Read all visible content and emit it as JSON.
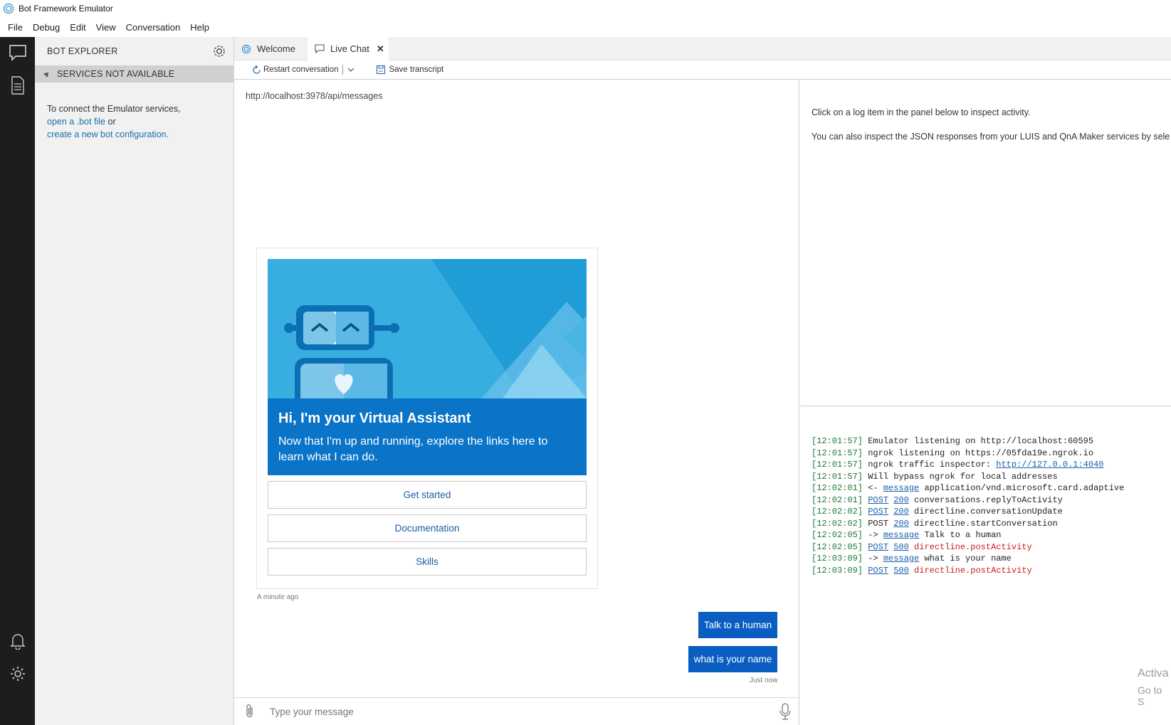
{
  "window": {
    "title": "Bot Framework Emulator"
  },
  "menu": {
    "items": [
      "File",
      "Debug",
      "Edit",
      "View",
      "Conversation",
      "Help"
    ]
  },
  "explorer": {
    "title": "BOT EXPLORER",
    "section": "SERVICES NOT AVAILABLE",
    "body_text": "To connect the Emulator services,",
    "link_open": "open a .bot file",
    "or_text": "or",
    "link_create": "create a new bot configuration."
  },
  "tabs": [
    {
      "label": "Welcome"
    },
    {
      "label": "Live Chat",
      "close": "✕"
    }
  ],
  "toolbar": {
    "restart_label": "Restart conversation",
    "save_label": "Save transcript"
  },
  "chat": {
    "endpoint": "http://localhost:3978/api/messages",
    "card": {
      "title_prefix": "Hi, I'm ",
      "title_bold": "your",
      "title_suffix": " Virtual Assistant",
      "subtitle": "Now that I'm up and running, explore the links here to learn what I can do.",
      "buttons": [
        "Get started",
        "Documentation",
        "Skills"
      ]
    },
    "card_timestamp": "A minute ago",
    "user_messages": [
      "Talk to a human",
      "what is your name"
    ],
    "last_timestamp": "Just now",
    "input_placeholder": "Type your message"
  },
  "inspector": {
    "line1": "Click on a log item in the panel below to inspect activity.",
    "line2": "You can also inspect the JSON responses from your LUIS and QnA Maker services by sele"
  },
  "log": [
    {
      "ts": "[12:01:57]",
      "parts": [
        {
          "t": "txt",
          "v": "Emulator listening on http://localhost:60595"
        }
      ]
    },
    {
      "ts": "[12:01:57]",
      "parts": [
        {
          "t": "txt",
          "v": "ngrok listening on https://05fda19e.ngrok.io"
        }
      ]
    },
    {
      "ts": "[12:01:57]",
      "parts": [
        {
          "t": "txt",
          "v": "ngrok traffic inspector: "
        },
        {
          "t": "lk",
          "v": "http://127.0.0.1:4040"
        }
      ]
    },
    {
      "ts": "[12:01:57]",
      "parts": [
        {
          "t": "txt",
          "v": "Will bypass ngrok for local addresses"
        }
      ]
    },
    {
      "ts": "[12:02:01]",
      "parts": [
        {
          "t": "txt",
          "v": "<- "
        },
        {
          "t": "lk",
          "v": "message"
        },
        {
          "t": "txt",
          "v": " application/vnd.microsoft.card.adaptive"
        }
      ]
    },
    {
      "ts": "[12:02:01]",
      "parts": [
        {
          "t": "lk",
          "v": "POST"
        },
        {
          "t": "txt",
          "v": " "
        },
        {
          "t": "lk",
          "v": "200"
        },
        {
          "t": "txt",
          "v": " conversations.replyToActivity"
        }
      ]
    },
    {
      "ts": "[12:02:02]",
      "parts": [
        {
          "t": "lk",
          "v": "POST"
        },
        {
          "t": "txt",
          "v": " "
        },
        {
          "t": "lk",
          "v": "200"
        },
        {
          "t": "txt",
          "v": " directline.conversationUpdate"
        }
      ]
    },
    {
      "ts": "[12:02:02]",
      "parts": [
        {
          "t": "txt",
          "v": "POST "
        },
        {
          "t": "lk",
          "v": "200"
        },
        {
          "t": "txt",
          "v": " directline.startConversation"
        }
      ]
    },
    {
      "ts": "[12:02:05]",
      "parts": [
        {
          "t": "txt",
          "v": "-> "
        },
        {
          "t": "lk",
          "v": "message"
        },
        {
          "t": "txt",
          "v": " Talk to a human"
        }
      ]
    },
    {
      "ts": "[12:02:05]",
      "parts": [
        {
          "t": "lk",
          "v": "POST"
        },
        {
          "t": "txt",
          "v": " "
        },
        {
          "t": "lk",
          "v": "500"
        },
        {
          "t": "txt",
          "v": " "
        },
        {
          "t": "err",
          "v": "directline.postActivity"
        }
      ]
    },
    {
      "ts": "[12:03:09]",
      "parts": [
        {
          "t": "txt",
          "v": "-> "
        },
        {
          "t": "lk",
          "v": "message"
        },
        {
          "t": "txt",
          "v": " what is your name"
        }
      ]
    },
    {
      "ts": "[12:03:09]",
      "parts": [
        {
          "t": "lk",
          "v": "POST"
        },
        {
          "t": "txt",
          "v": " "
        },
        {
          "t": "lk",
          "v": "500"
        },
        {
          "t": "txt",
          "v": " "
        },
        {
          "t": "err",
          "v": "directline.postActivity"
        }
      ]
    }
  ],
  "watermark": {
    "line1": "Activa",
    "line2": "Go to S"
  },
  "colors": {
    "accent": "#0a5ec2",
    "card_blue": "#0a74c8",
    "sidebar": "#1d1d1d"
  }
}
